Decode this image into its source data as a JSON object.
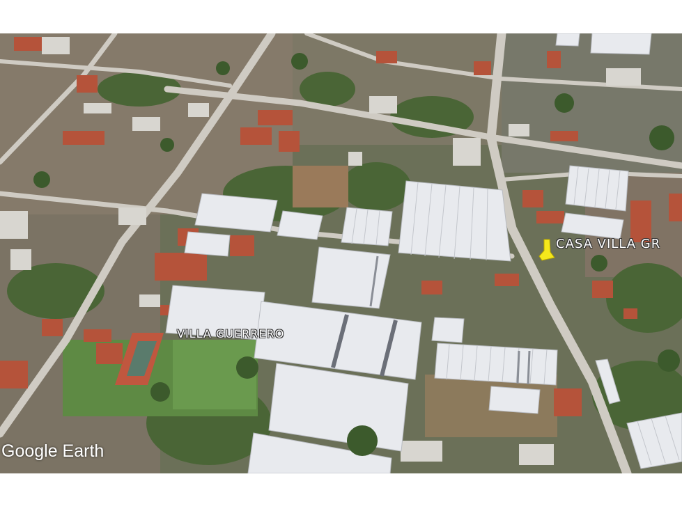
{
  "map": {
    "labels": {
      "villa_guerrero": "VILLA GUERRERO",
      "casa_villa": "CASA VILLA GR"
    },
    "watermark": "Google Earth",
    "pin_color": "#f5e81c",
    "palette": {
      "vegetation": "#4d6b3a",
      "road": "#c9c6be",
      "greenhouse": "#e8eaee",
      "roof_red": "#b5533a"
    }
  }
}
